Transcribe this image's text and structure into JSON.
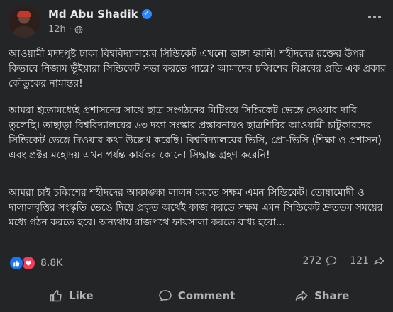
{
  "post": {
    "author": "Md Abu Shadik",
    "time": "12h",
    "dot": "·",
    "paragraphs": [
      "আওয়ামী মদদপুষ্ট ঢাকা বিশ্ববিদ্যালয়ের সিন্ডিকেট এখনো ভাঙ্গা হয়নি! শহীদদের রক্তের উপর কিভাবে নিজাম ভূঁইয়ারা সিন্ডিকেট সভা করতে পারে? আমাদের চব্বিশের বিপ্লবের প্রতি এক প্রকার কৌতুকের নামান্তর!",
      "আমরা ইতোমধ্যেই প্রশাসনের সাথে ছাত্র সংগঠনের মিটিংয়ে সিন্ডিকেট ভেঙ্গে দেওয়ার দাবি তুলেছি। তাছাড়া বিশ্ববিদ্যালয়ের ৬৩ দফা সংস্কার প্রস্তাবনায়ও ছাত্রশিবির আওয়ামী চাটুকারদের সিন্ডিকেট ভেঙ্গে দিওয়ার কথা উল্লেখ করেছি। বিশ্ববিদ্যালয়ের ভিসি, প্রো-ভিসি (শিক্ষা ও প্রশাসন) এবং প্রক্টর মহোদয় এখন পর্যন্ত কার্যকর কোনো সিদ্ধান্ত গ্রহণ করেনি!",
      "আমরা চাই চব্বিশের শহীদদের আকাঙ্ক্ষা লালন করতে সক্ষম এমন সিন্ডিকেট। তোষামোদী ও দালালবৃত্তির সংস্কৃতি ভেঙে দিয়ে প্রকৃত অর্থেই কাজ করতে সক্ষম এমন সিন্ডিকেট দ্রুততম সময়ের মধ্যে গঠন করতে হবে। অন্যথায় রাজপথে ফায়সালা করতে বাধ্য হবো..."
    ],
    "reaction_count": "8.8K",
    "comment_count": "272",
    "share_count": "121"
  },
  "actions": {
    "like": "Like",
    "comment": "Comment",
    "share": "Share"
  },
  "icons": {
    "verified": "verified-badge-icon",
    "audience": "globe-icon",
    "more": "more-options-icon",
    "like_reaction": "like-reaction-icon",
    "love_reaction": "love-reaction-icon"
  },
  "colors": {
    "background": "#242526",
    "text_primary": "#e4e6eb",
    "text_secondary": "#b0b3b8",
    "like_blue": "#1877f2",
    "love_red": "#f33e58",
    "verified_blue": "#2d88ff"
  }
}
